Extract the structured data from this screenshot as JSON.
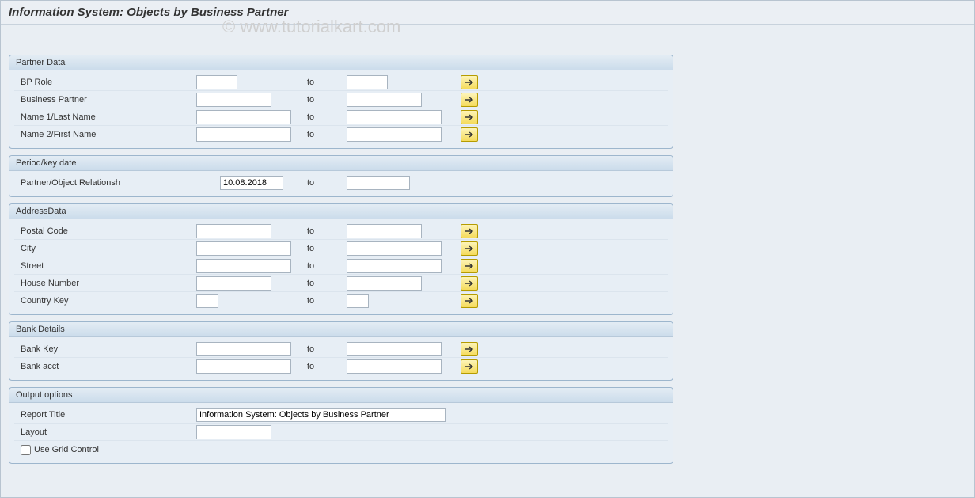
{
  "page_title": "Information System: Objects by Business Partner",
  "watermark": "© www.tutorialkart.com",
  "to_label": "to",
  "groups": {
    "partner_data": {
      "title": "Partner Data",
      "rows": {
        "bp_role": {
          "label": "BP Role",
          "from": "",
          "to": ""
        },
        "business_partner": {
          "label": "Business Partner",
          "from": "",
          "to": ""
        },
        "name1": {
          "label": "Name 1/Last Name",
          "from": "",
          "to": ""
        },
        "name2": {
          "label": "Name 2/First Name",
          "from": "",
          "to": ""
        }
      }
    },
    "period": {
      "title": "Period/key date",
      "rows": {
        "relationship": {
          "label": "Partner/Object Relationsh",
          "from": "10.08.2018",
          "to": ""
        }
      }
    },
    "address": {
      "title": "AddressData",
      "rows": {
        "postal": {
          "label": "Postal Code",
          "from": "",
          "to": ""
        },
        "city": {
          "label": "City",
          "from": "",
          "to": ""
        },
        "street": {
          "label": "Street",
          "from": "",
          "to": ""
        },
        "house": {
          "label": "House Number",
          "from": "",
          "to": ""
        },
        "country": {
          "label": "Country Key",
          "from": "",
          "to": ""
        }
      }
    },
    "bank": {
      "title": "Bank Details",
      "rows": {
        "bank_key": {
          "label": "Bank Key",
          "from": "",
          "to": ""
        },
        "bank_acct": {
          "label": "Bank acct",
          "from": "",
          "to": ""
        }
      }
    },
    "output": {
      "title": "Output options",
      "report_title_label": "Report Title",
      "report_title_value": "Information System: Objects by Business Partner",
      "layout_label": "Layout",
      "layout_value": "",
      "use_grid_label": "Use Grid Control",
      "use_grid_checked": false
    }
  }
}
